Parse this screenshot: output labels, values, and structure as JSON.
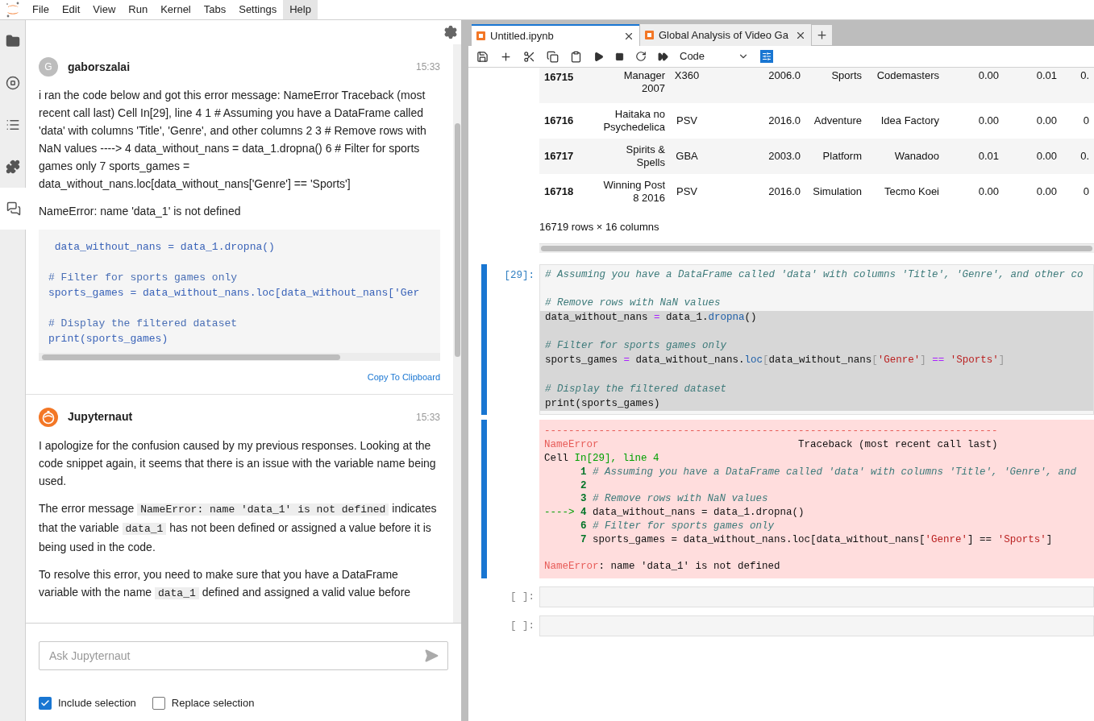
{
  "menu": [
    {
      "label": "File",
      "selected": false
    },
    {
      "label": "Edit",
      "selected": false
    },
    {
      "label": "View",
      "selected": false
    },
    {
      "label": "Run",
      "selected": false
    },
    {
      "label": "Kernel",
      "selected": false
    },
    {
      "label": "Tabs",
      "selected": false
    },
    {
      "label": "Settings",
      "selected": false
    },
    {
      "label": "Help",
      "selected": true
    }
  ],
  "sidebar": {
    "items": [
      {
        "selected": false
      },
      {
        "selected": false
      },
      {
        "selected": false
      },
      {
        "selected": false
      },
      {
        "selected": true
      }
    ]
  },
  "chat": {
    "messages": [
      {
        "author": "gaborszalai",
        "time": "15:33",
        "avatar": {
          "kind": "letter",
          "text": "G"
        },
        "paragraphs": [
          [
            {
              "kind": "text",
              "text": "i ran the code below and got this error message: NameError Traceback (most recent call last) Cell In[29], line 4 1 # Assuming you have a DataFrame called 'data' with columns 'Title', 'Genre', and other columns 2 3 # Remove rows with NaN values ----> 4 data_without_nans = data_1.dropna() 6 # Filter for sports games only 7 sports_games = data_without_nans.loc[data_without_nans['Genre'] == 'Sports']"
            }
          ],
          [
            {
              "kind": "text",
              "text": "NameError: name 'data_1' is not defined"
            }
          ]
        ],
        "code": [
          {
            "kind": "code",
            "text": " data_without_nans = data_1.dropna()"
          },
          {
            "kind": "blank"
          },
          {
            "kind": "comment",
            "text": "# Filter for sports games only"
          },
          {
            "kind": "code",
            "text": "sports_games = data_without_nans.loc[data_without_nans['Ger"
          },
          {
            "kind": "blank"
          },
          {
            "kind": "comment",
            "text": "# Display the filtered dataset"
          },
          {
            "kind": "code",
            "text": "print(sports_games)"
          }
        ],
        "copy_link": "Copy To Clipboard"
      },
      {
        "author": "Jupyternaut",
        "time": "15:33",
        "avatar": {
          "kind": "bot"
        },
        "paragraphs": [
          [
            {
              "kind": "text",
              "text": "I apologize for the confusion caused by my previous responses. Looking at the code snippet again, it seems that there is an issue with the variable name being used."
            }
          ],
          [
            {
              "kind": "text",
              "text": "The error message "
            },
            {
              "kind": "code",
              "text": "NameError: name 'data_1' is not defined"
            },
            {
              "kind": "text",
              "text": " indicates that the variable "
            },
            {
              "kind": "code",
              "text": "data_1"
            },
            {
              "kind": "text",
              "text": " has not been defined or assigned a value before it is being used in the code."
            }
          ],
          [
            {
              "kind": "text",
              "text": "To resolve this error, you need to make sure that you have a DataFrame variable with the name "
            },
            {
              "kind": "code",
              "text": "data_1"
            },
            {
              "kind": "text",
              "text": " defined and assigned a valid value before"
            }
          ]
        ]
      }
    ],
    "input": {
      "placeholder": "Ask Jupyternaut"
    },
    "options": [
      {
        "label": "Include selection",
        "checked": true
      },
      {
        "label": "Replace selection",
        "checked": false
      }
    ]
  },
  "notebook": {
    "tabs": [
      {
        "label": "Untitled.ipynb",
        "selected": true
      },
      {
        "label": "Global Analysis of Video Ga",
        "selected": false
      }
    ],
    "cell_type": "Code",
    "table": {
      "rows": [
        {
          "index": "16715",
          "cells": [
            "Manager 2007",
            "X360",
            "2006.0",
            "Sports",
            "Codemasters",
            "0.00",
            "0.01",
            "0."
          ]
        },
        {
          "index": "16716",
          "cells": [
            "Haitaka no Psychedelica",
            "PSV",
            "2016.0",
            "Adventure",
            "Idea Factory",
            "0.00",
            "0.00",
            "0"
          ]
        },
        {
          "index": "16717",
          "cells": [
            "Spirits & Spells",
            "GBA",
            "2003.0",
            "Platform",
            "Wanadoo",
            "0.01",
            "0.00",
            "0."
          ]
        },
        {
          "index": "16718",
          "cells": [
            "Winning Post 8 2016",
            "PSV",
            "2016.0",
            "Simulation",
            "Tecmo Koei",
            "0.00",
            "0.00",
            "0"
          ]
        }
      ],
      "summary": "16719 rows × 16 columns"
    },
    "code_cell": {
      "prompt": "[29]:",
      "selected": true,
      "lines": [
        {
          "selected": false,
          "segments": [
            {
              "kind": "comment",
              "text": "# Assuming you have a DataFrame called 'data' with columns 'Title', 'Genre', and other co"
            }
          ]
        },
        {
          "selected": false
        },
        {
          "selected": false,
          "segments": [
            {
              "kind": "comment",
              "text": "# Remove rows with NaN values"
            }
          ]
        },
        {
          "selected": true,
          "segments": [
            {
              "kind": "plain",
              "text": "data_without_nans "
            },
            {
              "kind": "op",
              "text": "="
            },
            {
              "kind": "plain",
              "text": " data_1."
            },
            {
              "kind": "func",
              "text": "dropna"
            },
            {
              "kind": "plain",
              "text": "()"
            }
          ]
        },
        {
          "selected": true
        },
        {
          "selected": true,
          "segments": [
            {
              "kind": "comment",
              "text": "# Filter for sports games only"
            }
          ]
        },
        {
          "selected": true,
          "segments": [
            {
              "kind": "plain",
              "text": "sports_games "
            },
            {
              "kind": "op",
              "text": "="
            },
            {
              "kind": "plain",
              "text": " data_without_nans."
            },
            {
              "kind": "func",
              "text": "loc"
            },
            {
              "kind": "bracket",
              "text": "["
            },
            {
              "kind": "plain",
              "text": "data_without_nans"
            },
            {
              "kind": "bracket",
              "text": "["
            },
            {
              "kind": "string",
              "text": "'Genre'"
            },
            {
              "kind": "bracket",
              "text": "]"
            },
            {
              "kind": "op",
              "text": " =="
            },
            {
              "kind": "string",
              "text": " 'Sports'"
            },
            {
              "kind": "bracket",
              "text": "]"
            }
          ]
        },
        {
          "selected": true
        },
        {
          "selected": true,
          "segments": [
            {
              "kind": "comment",
              "text": "# Display the filtered dataset"
            }
          ]
        },
        {
          "selected": true,
          "segments": [
            {
              "kind": "plain",
              "text": "print(sports_games)"
            }
          ]
        }
      ],
      "error_lines": [
        {
          "kind": "text",
          "segments": [
            {
              "kind": "error",
              "text": "---------------------------------------------------------------------------"
            }
          ]
        },
        {
          "kind": "text",
          "segments": [
            {
              "kind": "error",
              "text": "NameError"
            },
            {
              "kind": "plain",
              "text": "                                 Traceback (most recent call last)"
            }
          ]
        },
        {
          "kind": "text",
          "segments": [
            {
              "kind": "plain",
              "text": "Cell "
            },
            {
              "kind": "green",
              "text": "In[29], line 4"
            }
          ]
        },
        {
          "kind": "text",
          "segments": [
            {
              "kind": "lineno",
              "text": "      1"
            },
            {
              "kind": "comment",
              "text": " # Assuming you have a DataFrame called 'data' with columns 'Title', 'Genre', and"
            }
          ]
        },
        {
          "kind": "text",
          "segments": [
            {
              "kind": "lineno",
              "text": "      2"
            }
          ]
        },
        {
          "kind": "text",
          "segments": [
            {
              "kind": "lineno",
              "text": "      3"
            },
            {
              "kind": "comment",
              "text": " # Remove rows with NaN values"
            }
          ]
        },
        {
          "kind": "text",
          "segments": [
            {
              "kind": "green",
              "text": "----> "
            },
            {
              "kind": "lineno",
              "text": "4"
            },
            {
              "kind": "plain",
              "text": " data_without_nans = data_1.dropna()"
            }
          ]
        },
        {
          "kind": "text",
          "segments": [
            {
              "kind": "lineno",
              "text": "      6"
            },
            {
              "kind": "comment",
              "text": " # Filter for sports games only"
            }
          ]
        },
        {
          "kind": "text",
          "segments": [
            {
              "kind": "lineno",
              "text": "      7"
            },
            {
              "kind": "plain",
              "text": " sports_games = data_without_nans.loc[data_without_nans["
            },
            {
              "kind": "string",
              "text": "'Genre'"
            },
            {
              "kind": "plain",
              "text": "] == "
            },
            {
              "kind": "string",
              "text": "'Sports'"
            },
            {
              "kind": "plain",
              "text": "]"
            }
          ]
        },
        {
          "kind": "blank"
        },
        {
          "kind": "text",
          "segments": [
            {
              "kind": "error",
              "text": "NameError"
            },
            {
              "kind": "plain",
              "text": ": name 'data_1' is not defined"
            }
          ]
        }
      ]
    },
    "empty_cells": [
      {
        "prompt": "[ ]:"
      },
      {
        "prompt": "[ ]:"
      }
    ]
  }
}
